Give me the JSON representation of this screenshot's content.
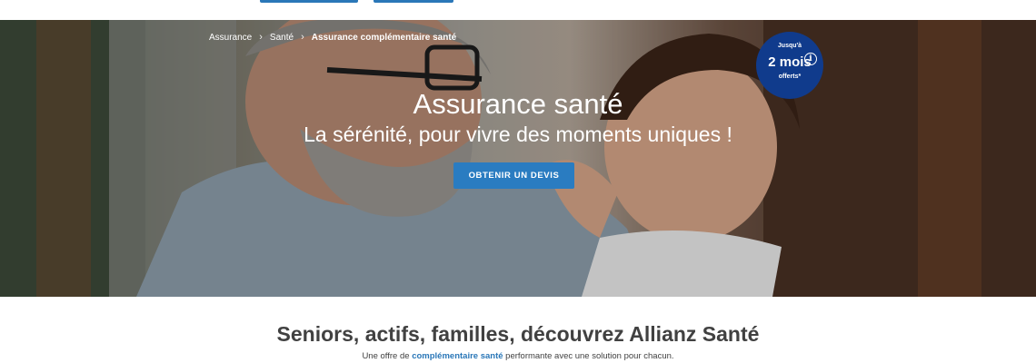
{
  "breadcrumb": {
    "items": [
      "Assurance",
      "Santé",
      "Assurance complémentaire santé"
    ],
    "separator": "›"
  },
  "hero": {
    "title": "Assurance santé",
    "subtitle": "La sérénité, pour vivre des moments uniques !",
    "cta_label": "OBTENIR UN DEVIS",
    "promo": {
      "pre": "Jusqu'à",
      "big": "2 mois",
      "post": "offerts*",
      "info_icon": "i"
    }
  },
  "section": {
    "title": "Seniors, actifs, familles, découvrez Allianz Santé",
    "text_before": "Une offre de ",
    "link": "complémentaire santé",
    "text_after": " performante avec une solution pour chacun."
  },
  "colors": {
    "accent": "#2a7cc1",
    "promo_bg": "#103b8c",
    "text": "#414141"
  }
}
